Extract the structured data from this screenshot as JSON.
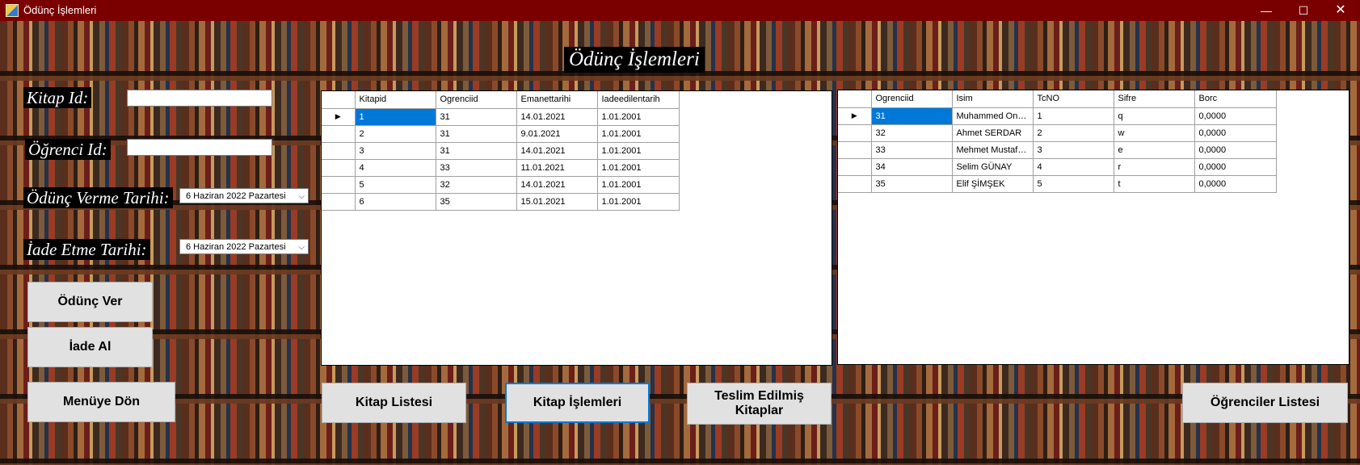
{
  "window": {
    "title": "Ödünç İşlemleri",
    "min": "—",
    "max": "☐",
    "close": "✕"
  },
  "heading": "Ödünç İşlemleri",
  "form": {
    "kitap_id_label": "Kitap Id:",
    "kitap_id_value": "",
    "ogrenci_id_label": "Öğrenci Id:",
    "ogrenci_id_value": "",
    "odunc_tarihi_label": "Ödünç Verme Tarihi:",
    "odunc_tarihi_value": "6  Haziran  2022  Pazartesi",
    "iade_tarihi_label": "İade Etme Tarihi:",
    "iade_tarihi_value": "6  Haziran  2022  Pazartesi"
  },
  "buttons": {
    "odunc_ver": "Ödünç Ver",
    "iade_al": "İade Al",
    "menuye_don": "Menüye Dön",
    "kitap_listesi": "Kitap Listesi",
    "kitap_islemleri": "Kitap İşlemleri",
    "teslim_line1": "Teslim Edilmiş",
    "teslim_line2": "Kitaplar",
    "ogrenciler_listesi": "Öğrenciler Listesi"
  },
  "loans_grid": {
    "columns": [
      "Kitapid",
      "Ogrenciid",
      "Emanettarihi",
      "Iadeedilentarih"
    ],
    "rows": [
      [
        "1",
        "31",
        "14.01.2021",
        "1.01.2001"
      ],
      [
        "2",
        "31",
        "9.01.2021",
        "1.01.2001"
      ],
      [
        "3",
        "31",
        "14.01.2021",
        "1.01.2001"
      ],
      [
        "4",
        "33",
        "11.01.2021",
        "1.01.2001"
      ],
      [
        "5",
        "32",
        "14.01.2021",
        "1.01.2001"
      ],
      [
        "6",
        "35",
        "15.01.2021",
        "1.01.2001"
      ]
    ]
  },
  "students_grid": {
    "columns": [
      "Ogrenciid",
      "Isim",
      "TcNO",
      "Sifre",
      "Borc"
    ],
    "rows": [
      [
        "31",
        "Muhammed Onur...",
        "1",
        "q",
        "0,0000"
      ],
      [
        "32",
        "Ahmet SERDAR",
        "2",
        "w",
        "0,0000"
      ],
      [
        "33",
        "Mehmet Mustafa ...",
        "3",
        "e",
        "0,0000"
      ],
      [
        "34",
        "Selim GÜNAY",
        "4",
        "r",
        "0,0000"
      ],
      [
        "35",
        "Elif ŞİMŞEK",
        "5",
        "t",
        "0,0000"
      ]
    ]
  },
  "icons": {
    "row_indicator": "▶",
    "dropdown": "⌵"
  },
  "colors": {
    "titlebar": "#7a0000",
    "selection": "#0078d7"
  }
}
